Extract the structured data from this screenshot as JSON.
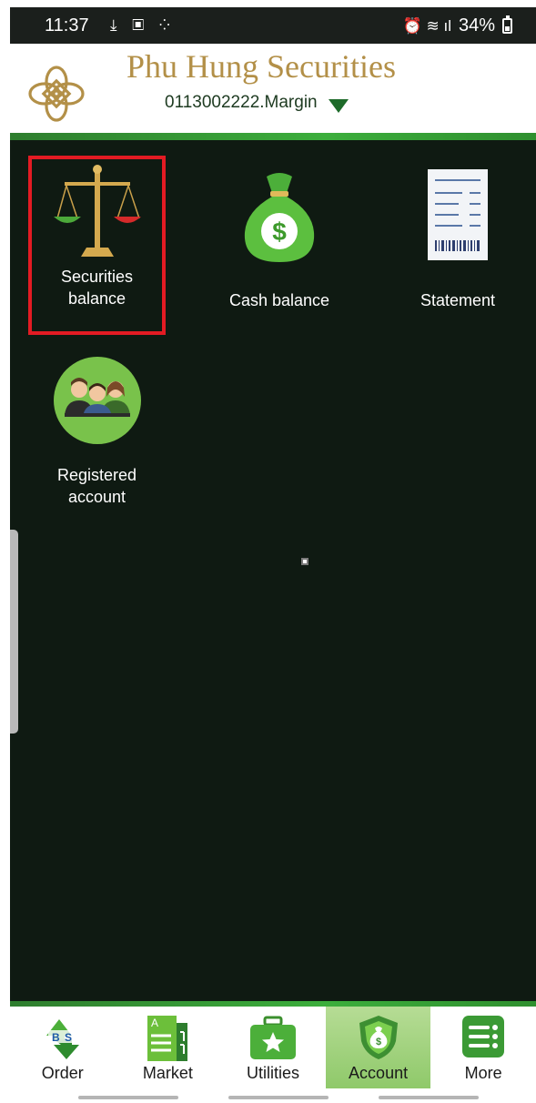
{
  "status_bar": {
    "time": "11:37",
    "left_icons": "⤓ ▣ ⁘",
    "right_icons": "⏰ ≋ ıl",
    "battery": "34%"
  },
  "header": {
    "brand": "Phu Hung Securities",
    "account": "0113002222.Margin"
  },
  "tiles": [
    {
      "label_line1": "Securities",
      "label_line2": "balance",
      "icon": "scales-icon",
      "selected": true
    },
    {
      "label_line1": "Cash balance",
      "label_line2": "",
      "icon": "money-bag-icon",
      "selected": false
    },
    {
      "label_line1": "Statement",
      "label_line2": "",
      "icon": "receipt-icon",
      "selected": false
    },
    {
      "label_line1": "Registered",
      "label_line2": "account",
      "icon": "people-icon",
      "selected": false
    }
  ],
  "nav": {
    "items": [
      {
        "label": "Order",
        "icon": "buy-sell-icon"
      },
      {
        "label": "Market",
        "icon": "market-board-icon"
      },
      {
        "label": "Utilities",
        "icon": "star-briefcase-icon"
      },
      {
        "label": "Account",
        "icon": "shield-money-icon",
        "active": true
      },
      {
        "label": "More",
        "icon": "menu-list-icon"
      }
    ]
  },
  "colors": {
    "brand_gold": "#b39048",
    "background": "#0f1a12",
    "accent_green": "#3cae3c",
    "highlight_red": "#e31b23"
  }
}
